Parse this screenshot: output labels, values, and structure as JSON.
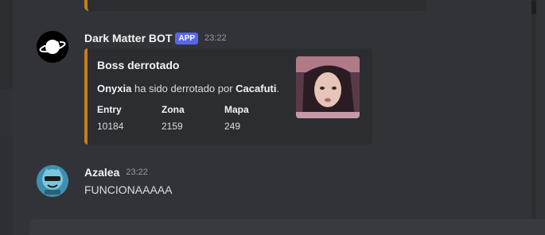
{
  "previous_embed": {
    "accent": "#c67d1c"
  },
  "message_bot": {
    "username": "Dark Matter BOT",
    "badge": "APP",
    "timestamp": "23:22",
    "avatar_icon": "planet-ring-icon",
    "embed": {
      "accent": "#c67d1c",
      "title": "Boss derrotado",
      "description": {
        "boss": "Onyxia",
        "middle": " ha sido derrotado por ",
        "player": "Cacafuti",
        "end": "."
      },
      "fields": [
        {
          "name": "Entry",
          "value": "10184"
        },
        {
          "name": "Zona",
          "value": "2159"
        },
        {
          "name": "Mapa",
          "value": "249"
        }
      ],
      "thumbnail_icon": "portrait-thumbnail"
    }
  },
  "message_user": {
    "username": "Azalea",
    "timestamp": "23:22",
    "avatar_icon": "cartoon-character-avatar",
    "content": "FUNCIONAAAAA"
  },
  "colors": {
    "background": "#323339",
    "embed_bg": "#2b2d31",
    "badge": "#5865f2"
  }
}
